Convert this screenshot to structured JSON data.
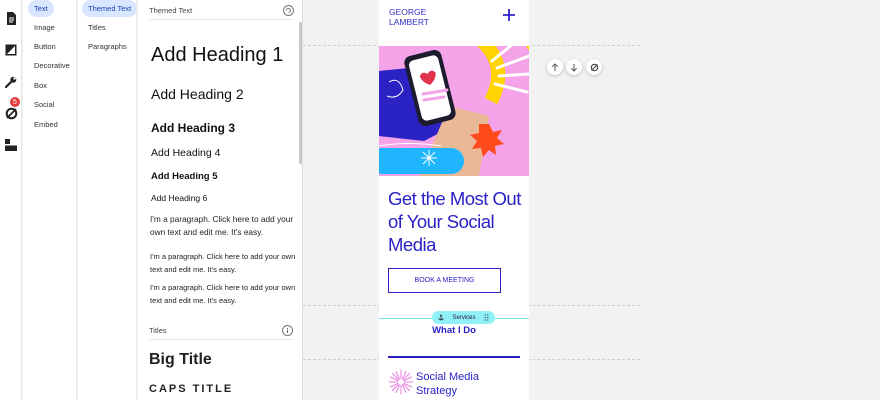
{
  "left_rail": {
    "icons": [
      "pages-icon",
      "design-icon",
      "tools-icon",
      "hide-icon",
      "layers-icon"
    ],
    "badge_count": "5"
  },
  "categories": [
    "Text",
    "Image",
    "Button",
    "Decorative",
    "Box",
    "Social",
    "Embed"
  ],
  "active_category": "Text",
  "subcategories": [
    "Themed Text",
    "Titles",
    "Paragraphs"
  ],
  "active_subcategory": "Themed Text",
  "panel": {
    "themed_title": "Themed Text",
    "headings": [
      "Add Heading 1",
      "Add Heading 2",
      "Add Heading 3",
      "Add Heading 4",
      "Add Heading 5",
      "Add Heading 6"
    ],
    "paragraphs": [
      "I'm a paragraph. Click here to add your own text and edit me. It's easy.",
      "I'm a paragraph. Click here to add your own text and edit me. It's easy.",
      "I'm a paragraph. Click here to add your own text and edit me. It's easy."
    ],
    "titles_title": "Titles",
    "big_title": "Big Title",
    "caps_title": "CAPS TITLE"
  },
  "site": {
    "logo_line1": "GEORGE",
    "logo_line2": "LAMBERT",
    "headline": "Get the Most Out of Your Social Media",
    "cta": "BOOK A MEETING",
    "anchor_label": "Services",
    "section_title": "What I Do",
    "service_1": "Social Media Strategy"
  },
  "colors": {
    "brand": "#2b22c4",
    "hero_pink": "#f4a3e8",
    "anchor": "#8ff1f7",
    "active_pill": "#d9e6ff"
  }
}
